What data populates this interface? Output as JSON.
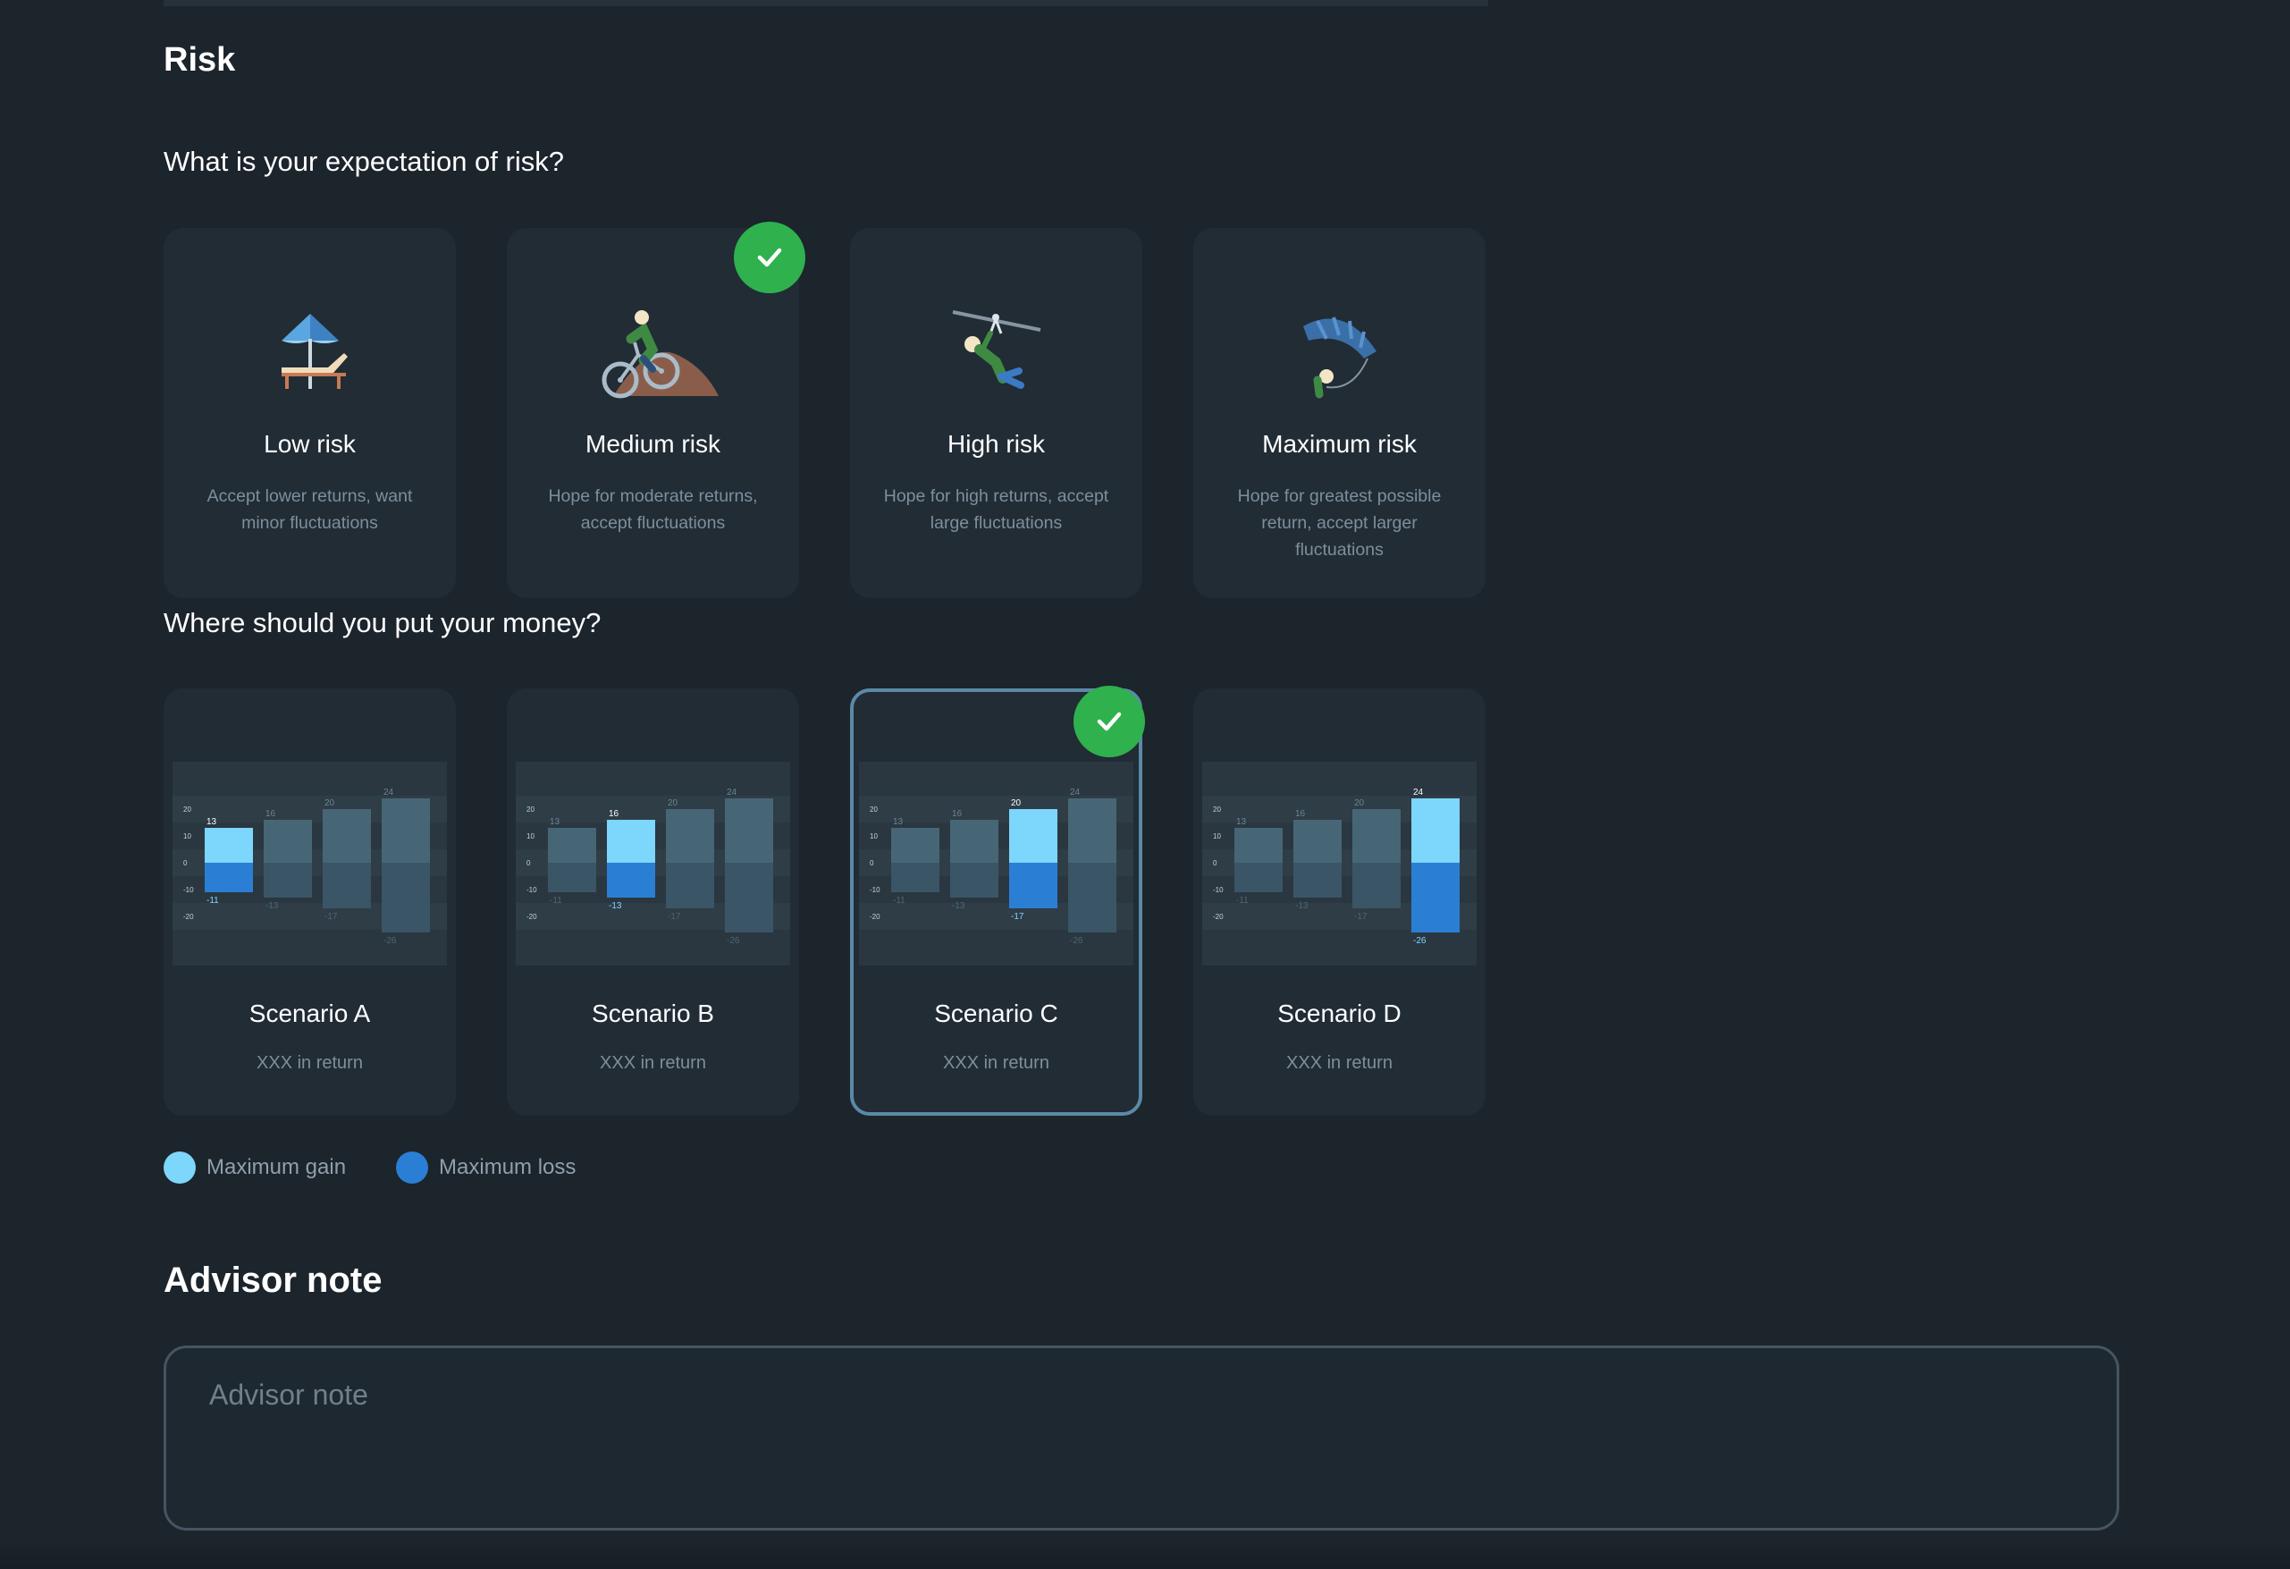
{
  "section_title": "Risk",
  "question_risk": "What is your expectation of risk?",
  "risk_options": [
    {
      "label": "Low risk",
      "description": "Accept lower returns, want minor fluctuations",
      "icon": "beach-umbrella-icon",
      "selected": false
    },
    {
      "label": "Medium risk",
      "description": "Hope for moderate returns, accept fluctuations",
      "icon": "mountain-biker-icon",
      "selected": true
    },
    {
      "label": "High risk",
      "description": "Hope for high returns, accept large fluctuations",
      "icon": "zipline-icon",
      "selected": false
    },
    {
      "label": "Maximum risk",
      "description": "Hope for greatest possible return, accept larger fluctuations",
      "icon": "parachute-icon",
      "selected": false
    }
  ],
  "question_money": "Where should you put your money?",
  "scenarios": [
    {
      "label": "Scenario A",
      "subtitle": "XXX in return",
      "highlight_index": 0,
      "selected": false
    },
    {
      "label": "Scenario B",
      "subtitle": "XXX in return",
      "highlight_index": 1,
      "selected": false
    },
    {
      "label": "Scenario C",
      "subtitle": "XXX in return",
      "highlight_index": 2,
      "selected": true
    },
    {
      "label": "Scenario D",
      "subtitle": "XXX in return",
      "highlight_index": 3,
      "selected": false
    }
  ],
  "chart_data": {
    "type": "bar",
    "y_ticks": [
      20,
      10,
      0,
      -10,
      -20
    ],
    "ylim": [
      -30,
      30
    ],
    "series": [
      {
        "name": "Maximum gain",
        "values": [
          13,
          16,
          20,
          24
        ]
      },
      {
        "name": "Maximum loss",
        "values": [
          -11,
          -13,
          -17,
          -26
        ]
      }
    ]
  },
  "legend": {
    "gain_label": "Maximum gain",
    "loss_label": "Maximum loss"
  },
  "colors": {
    "gain": "#7dd6fb",
    "loss": "#2a7fd4",
    "muted": "#476675",
    "check": "#2fb14e",
    "selected_border": "#5a8aa6"
  },
  "advisor": {
    "title": "Advisor note",
    "placeholder": "Advisor note",
    "value": ""
  }
}
